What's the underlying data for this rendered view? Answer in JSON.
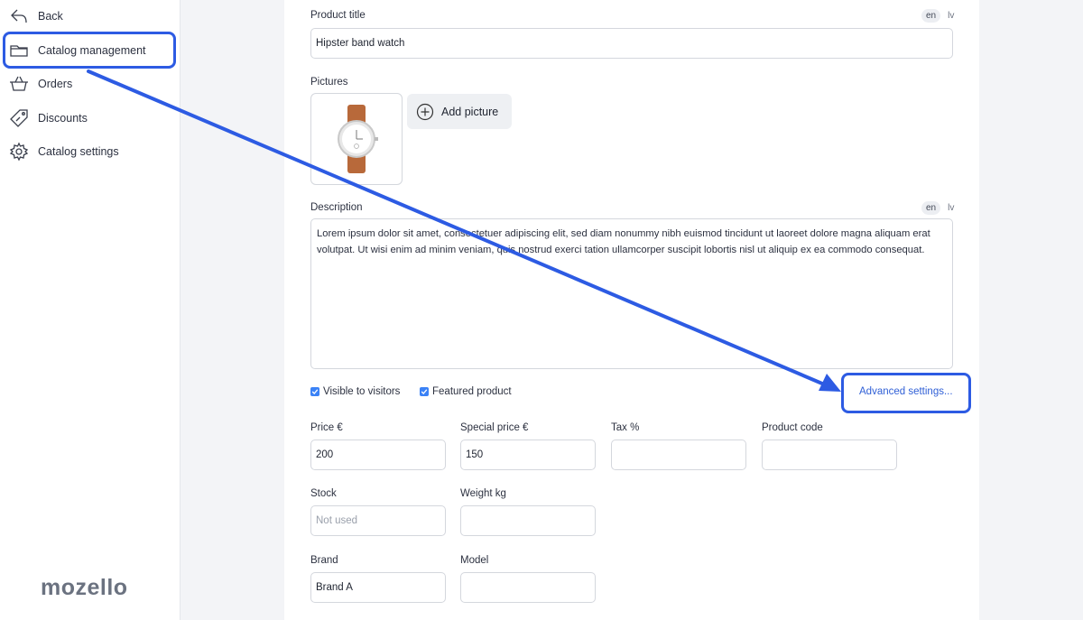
{
  "sidebar": {
    "items": [
      {
        "label": "Back",
        "icon": "back-arrow-icon"
      },
      {
        "label": "Catalog management",
        "icon": "folder-icon"
      },
      {
        "label": "Orders",
        "icon": "basket-icon"
      },
      {
        "label": "Discounts",
        "icon": "tag-icon"
      },
      {
        "label": "Catalog settings",
        "icon": "gear-icon"
      }
    ],
    "active_item": "Catalog management",
    "logo": "mozello"
  },
  "form": {
    "product_title_label": "Product title",
    "product_title_value": "Hipster band watch",
    "lang_en": "en",
    "lang_lv": "lv",
    "pictures_label": "Pictures",
    "add_picture_label": "Add picture",
    "description_label": "Description",
    "description_value": "Lorem ipsum dolor sit amet, consectetuer adipiscing elit, sed diam nonummy nibh euismod tincidunt ut laoreet dolore magna aliquam erat volutpat. Ut wisi enim ad minim veniam, quis nostrud exerci tation ullamcorper suscipit lobortis nisl ut aliquip ex ea commodo consequat.",
    "visible_to_visitors_label": "Visible to visitors",
    "visible_to_visitors_checked": true,
    "featured_product_label": "Featured product",
    "featured_product_checked": true,
    "advanced_settings_label": "Advanced settings...",
    "price_label": "Price €",
    "price_value": "200",
    "special_price_label": "Special price €",
    "special_price_value": "150",
    "tax_label": "Tax %",
    "tax_value": "",
    "product_code_label": "Product code",
    "product_code_value": "",
    "stock_label": "Stock",
    "stock_placeholder": "Not used",
    "weight_label": "Weight kg",
    "weight_value": "",
    "brand_label": "Brand",
    "brand_value": "Brand A",
    "model_label": "Model",
    "model_value": ""
  },
  "colors": {
    "accent": "#2d5be3",
    "checkbox": "#3b82f6",
    "link": "#2f5fd6"
  }
}
